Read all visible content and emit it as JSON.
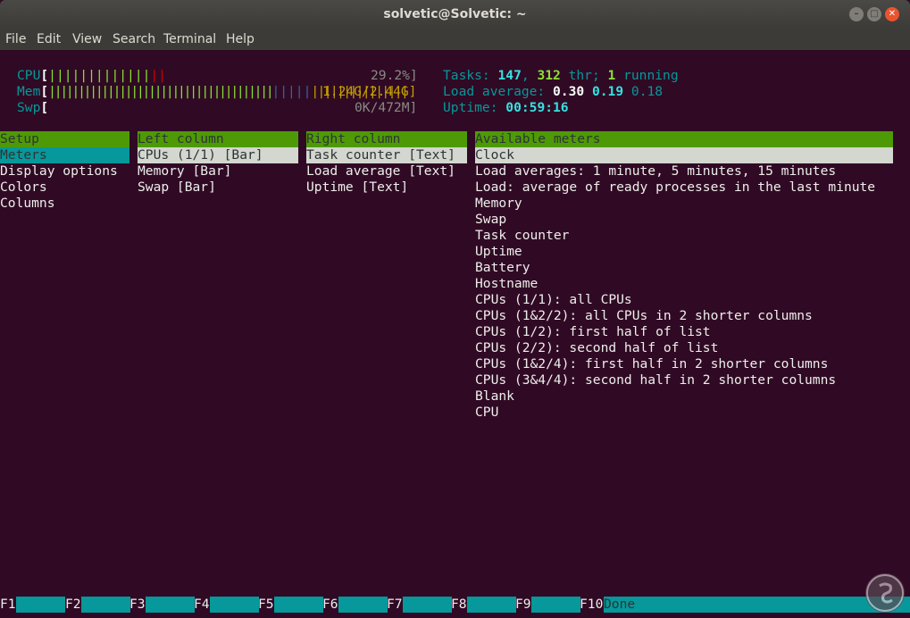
{
  "window": {
    "title": "solvetic@Solvetic: ~"
  },
  "menubar": [
    "File",
    "Edit",
    "View",
    "Search",
    "Terminal",
    "Help"
  ],
  "meters": {
    "cpu": {
      "label": "CPU",
      "bar_green": "|||||||||||||",
      "bar_red": "||",
      "value": "29.2%]"
    },
    "mem": {
      "label": "Mem",
      "bar_green": "||||||||||||||||||||||||||||||||||||||",
      "bar_blue": "|||||",
      "bar_yellow": "|||||||||||||||",
      "value": "1.24G/2.44G]"
    },
    "swp": {
      "label": "Swp",
      "value": "0K/472M]"
    }
  },
  "summary": {
    "tasks_label": "Tasks: ",
    "tasks": "147",
    "thr": "312",
    "thr_label": " thr; ",
    "running": "1",
    "running_label": " running",
    "load_label": "Load average: ",
    "load1": "0.30",
    "load5": "0.19",
    "load15": "0.18",
    "uptime_label": "Uptime: ",
    "uptime": "00:59:16"
  },
  "setup": {
    "header": "Setup",
    "items": [
      "Meters",
      "Display options",
      "Colors",
      "Columns"
    ]
  },
  "left_column": {
    "header": "Left column",
    "items": [
      "CPUs (1/1) [Bar]",
      "Memory [Bar]",
      "Swap [Bar]"
    ]
  },
  "right_column": {
    "header": "Right column",
    "items": [
      "Task counter [Text]",
      "Load average [Text]",
      "Uptime [Text]"
    ]
  },
  "available_meters": {
    "header": "Available meters",
    "items": [
      "Clock",
      "Load averages: 1 minute, 5 minutes, 15 minutes",
      "Load: average of ready processes in the last minute",
      "Memory",
      "Swap",
      "Task counter",
      "Uptime",
      "Battery",
      "Hostname",
      "CPUs (1/1): all CPUs",
      "CPUs (1&2/2): all CPUs in 2 shorter columns",
      "CPUs (1/2): first half of list",
      "CPUs (2/2): second half of list",
      "CPUs (1&2/4): first half in 2 shorter columns",
      "CPUs (3&4/4): second half in 2 shorter columns",
      "Blank",
      "CPU"
    ]
  },
  "function_keys": [
    {
      "key": "F1",
      "label": ""
    },
    {
      "key": "F2",
      "label": ""
    },
    {
      "key": "F3",
      "label": ""
    },
    {
      "key": "F4",
      "label": ""
    },
    {
      "key": "F5",
      "label": ""
    },
    {
      "key": "F6",
      "label": ""
    },
    {
      "key": "F7",
      "label": ""
    },
    {
      "key": "F8",
      "label": ""
    },
    {
      "key": "F9",
      "label": ""
    },
    {
      "key": "F10",
      "label": "Done"
    }
  ]
}
